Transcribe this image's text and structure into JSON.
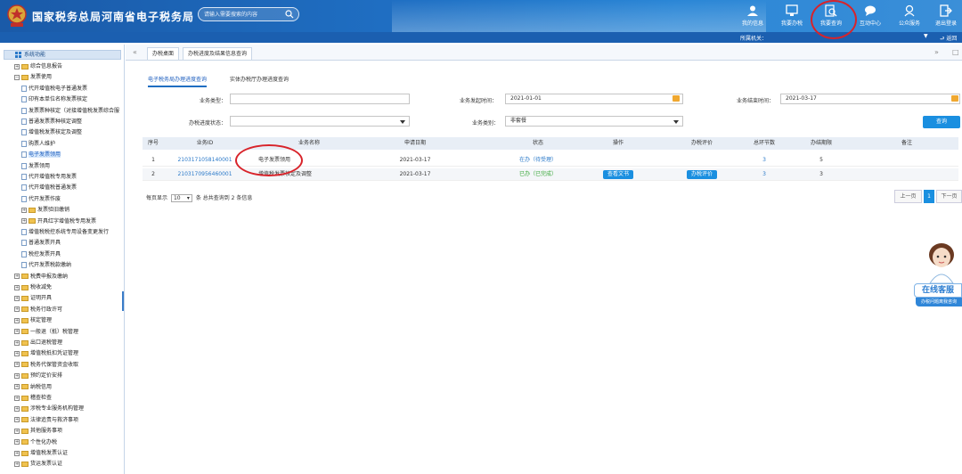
{
  "header": {
    "site_title": "国家税务总局河南省电子税务局",
    "search_placeholder": "请输入需要搜索的内容",
    "nav": [
      {
        "label": "我的信息",
        "icon": "user-icon"
      },
      {
        "label": "我要办税",
        "icon": "monitor-icon"
      },
      {
        "label": "我要查询",
        "icon": "search-doc-icon"
      },
      {
        "label": "互动中心",
        "icon": "chat-icon"
      },
      {
        "label": "公众服务",
        "icon": "service-icon"
      },
      {
        "label": "退出登录",
        "icon": "logout-icon"
      }
    ],
    "org_label": "所属机关：",
    "back_label": "返回"
  },
  "sidebar": {
    "title": "系统功能",
    "items": [
      {
        "label": "综合信息报告",
        "level": 0,
        "type": "folder",
        "expander": "+"
      },
      {
        "label": "发票使用",
        "level": 0,
        "type": "folder",
        "expander": "−"
      },
      {
        "label": "代开增值税电子普通发票",
        "level": 1,
        "type": "doc"
      },
      {
        "label": "印有本单位名称发票核定",
        "level": 1,
        "type": "doc"
      },
      {
        "label": "发票票种核定（对接增值税发票综合服",
        "level": 1,
        "type": "doc"
      },
      {
        "label": "普通发票票种核定调整",
        "level": 1,
        "type": "doc"
      },
      {
        "label": "增值税发票核定及调整",
        "level": 1,
        "type": "doc"
      },
      {
        "label": "购票人维护",
        "level": 1,
        "type": "doc"
      },
      {
        "label": "电子发票领用",
        "level": 1,
        "type": "doc",
        "selected": true
      },
      {
        "label": "发票领用",
        "level": 1,
        "type": "doc"
      },
      {
        "label": "代开增值税专用发票",
        "level": 1,
        "type": "doc"
      },
      {
        "label": "代开增值税普通发票",
        "level": 1,
        "type": "doc"
      },
      {
        "label": "代开发票作废",
        "level": 1,
        "type": "doc"
      },
      {
        "label": "发票验旧缴销",
        "level": 1,
        "type": "folder",
        "expander": "+"
      },
      {
        "label": "开具红字增值税专用发票",
        "level": 1,
        "type": "folder",
        "expander": "+"
      },
      {
        "label": "增值税税控系统专用设备变更发行",
        "level": 1,
        "type": "doc"
      },
      {
        "label": "普通发票开具",
        "level": 1,
        "type": "doc"
      },
      {
        "label": "税控发票开具",
        "level": 1,
        "type": "doc"
      },
      {
        "label": "代开发票税款缴纳",
        "level": 1,
        "type": "doc"
      },
      {
        "label": "税费申报及缴纳",
        "level": 0,
        "type": "folder",
        "expander": "+"
      },
      {
        "label": "税收减免",
        "level": 0,
        "type": "folder",
        "expander": "+"
      },
      {
        "label": "证明开具",
        "level": 0,
        "type": "folder",
        "expander": "+"
      },
      {
        "label": "税务行政许可",
        "level": 0,
        "type": "folder",
        "expander": "+"
      },
      {
        "label": "核定管理",
        "level": 0,
        "type": "folder",
        "expander": "+"
      },
      {
        "label": "一般退（抵）税管理",
        "level": 0,
        "type": "folder",
        "expander": "+"
      },
      {
        "label": "出口退税管理",
        "level": 0,
        "type": "folder",
        "expander": "+"
      },
      {
        "label": "增值税抵扣凭证管理",
        "level": 0,
        "type": "folder",
        "expander": "+"
      },
      {
        "label": "税务代保管资金收取",
        "level": 0,
        "type": "folder",
        "expander": "+"
      },
      {
        "label": "预约定价安排",
        "level": 0,
        "type": "folder",
        "expander": "+"
      },
      {
        "label": "纳税信用",
        "level": 0,
        "type": "folder",
        "expander": "+"
      },
      {
        "label": "稽查检查",
        "level": 0,
        "type": "folder",
        "expander": "+"
      },
      {
        "label": "涉税专业服务机构管理",
        "level": 0,
        "type": "folder",
        "expander": "+"
      },
      {
        "label": "法律追责与救济事项",
        "level": 0,
        "type": "folder",
        "expander": "+"
      },
      {
        "label": "其他服务事项",
        "level": 0,
        "type": "folder",
        "expander": "+"
      },
      {
        "label": "个性化办税",
        "level": 0,
        "type": "folder",
        "expander": "+"
      },
      {
        "label": "增值税发票认证",
        "level": 0,
        "type": "folder",
        "expander": "+"
      },
      {
        "label": "货运发票认证",
        "level": 0,
        "type": "folder",
        "expander": "+"
      }
    ]
  },
  "tabs": {
    "nav_left": "«",
    "items": [
      "办税桌面",
      "办税进度及结果信息查询"
    ],
    "nav_right": "»"
  },
  "subtabs": [
    "电子税务局办理进度查询",
    "实体办税厅办理进度查询"
  ],
  "form": {
    "business_type_label": "业务类型：",
    "start_time_label": "业务发起时间：",
    "start_time_value": "2021-01-01",
    "end_time_label": "业务结束时间：",
    "end_time_value": "2021-03-17",
    "progress_label": "办税进度状态：",
    "category_label": "业务类别：",
    "category_value": "非套餐",
    "query_button": "查询"
  },
  "table": {
    "headers": [
      "序号",
      "业务ID",
      "业务名称",
      "申请日期",
      "状态",
      "操作",
      "办税评价",
      "总环节数",
      "办结期限",
      "备注"
    ],
    "rows": [
      {
        "no": "1",
        "id": "2103171058140001",
        "name": "电子发票领用",
        "date": "2021-03-17",
        "status": "在办（待受理）",
        "action": "",
        "rating": "",
        "steps": "3",
        "deadline": "5",
        "remark": ""
      },
      {
        "no": "2",
        "id": "2103170956460001",
        "name": "增值税发票核定及调整",
        "date": "2021-03-17",
        "status": "已办（已完成）",
        "action": "查看文书",
        "rating": "办税评价",
        "steps": "3",
        "deadline": "3",
        "remark": ""
      }
    ]
  },
  "pager": {
    "per_page_prefix": "每页显示",
    "per_page_value": "10",
    "summary": "条 总共查询到 2 条信息",
    "prev": "上一页",
    "current": "1",
    "next": "下一页"
  },
  "customer_service": {
    "title": "在线客服",
    "subtitle": "办税问题离我咨询"
  },
  "colors": {
    "header_blue": "#1f6ec2",
    "accent_blue": "#1a8fe0",
    "annotation_red": "#d8232a"
  }
}
